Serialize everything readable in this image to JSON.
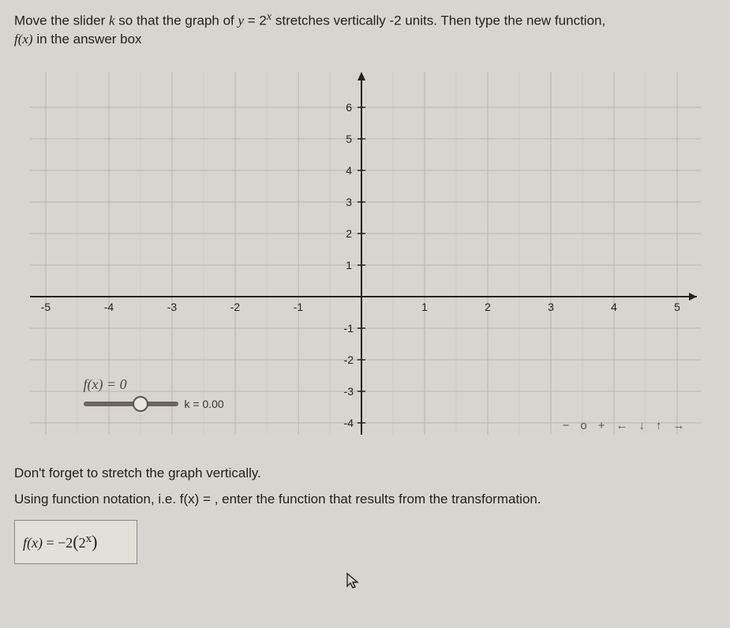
{
  "prompt": {
    "line1a": "Move the slider ",
    "k": "k",
    "line1b": " so that the graph of ",
    "eq_lhs": "y",
    "eq_eq": " = ",
    "eq_rhs_base": "2",
    "eq_rhs_exp": "x",
    "line1c": " stretches vertically -2 units. Then type the new function,",
    "line2a": "f(x)",
    "line2b": " in the answer box"
  },
  "graph": {
    "x_ticks": [
      "-5",
      "-4",
      "-3",
      "-2",
      "-1",
      "1",
      "2",
      "3",
      "4",
      "5"
    ],
    "y_ticks_pos": [
      "1",
      "2",
      "3",
      "4",
      "5",
      "6"
    ],
    "y_ticks_neg": [
      "-1",
      "-2",
      "-3",
      "-4"
    ],
    "slider_title_lhs": "f(x)",
    "slider_title_rhs": " = 0",
    "k_text": "k = 0.00"
  },
  "toolbar": {
    "minus": "−",
    "reset": "o",
    "plus": "+",
    "left": "←",
    "down": "↓",
    "up": "↑",
    "right": "→"
  },
  "below": {
    "reminder": "Don't forget to stretch the graph vertically.",
    "instr_a": "Using function notation, i.e. ",
    "instr_fx": "f(x) = ",
    "instr_b": ", enter the function that results from the transformation."
  },
  "answer": {
    "lhs": "f(x)",
    "eq": " = ",
    "neg2": "−2",
    "open": "(",
    "base": "2",
    "exp": "x",
    "close": ")"
  },
  "chart_data": {
    "type": "line",
    "title": "",
    "xlabel": "",
    "ylabel": "",
    "xlim": [
      -5.5,
      5.5
    ],
    "ylim": [
      -4,
      6.5
    ],
    "series": [
      {
        "name": "f(x)=0",
        "x": [
          -5,
          -4,
          -3,
          -2,
          -1,
          0,
          1,
          2,
          3,
          4,
          5
        ],
        "y": [
          0,
          0,
          0,
          0,
          0,
          0,
          0,
          0,
          0,
          0,
          0
        ]
      }
    ],
    "slider": {
      "name": "k",
      "value": 0.0
    }
  }
}
